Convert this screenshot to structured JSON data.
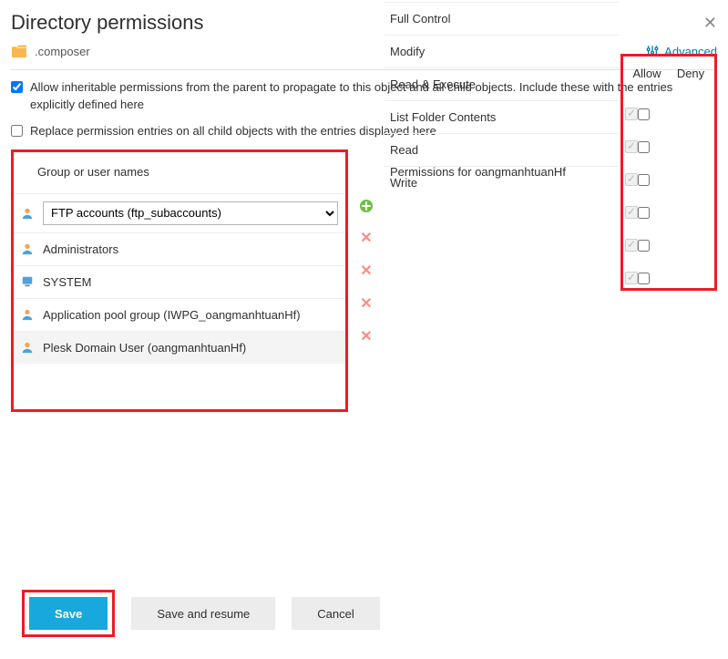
{
  "header": {
    "title": "Directory permissions"
  },
  "directory": {
    "name": ".composer"
  },
  "advanced": {
    "label": "Advanced"
  },
  "inherit": {
    "label": "Allow inheritable permissions from the parent to propagate to this object and all child objects. Include these with the entries explicitly defined here",
    "checked": true
  },
  "replace": {
    "label": "Replace permission entries on all child objects with the entries displayed here",
    "checked": false
  },
  "groups": {
    "header": "Group or user names",
    "select_value": "FTP accounts (ftp_subaccounts)",
    "items": [
      {
        "label": "Administrators",
        "kind": "user"
      },
      {
        "label": "SYSTEM",
        "kind": "system"
      },
      {
        "label": "Application pool group (IWPG_oangmanhtuanHf)",
        "kind": "user"
      },
      {
        "label": "Plesk Domain User (oangmanhtuanHf)",
        "kind": "user",
        "selected": true
      }
    ]
  },
  "permissions": {
    "header": "Permissions for oangmanhtuanHf",
    "allow_label": "Allow",
    "deny_label": "Deny",
    "rows": [
      {
        "label": "Full Control",
        "allow": true
      },
      {
        "label": "Modify",
        "allow": true
      },
      {
        "label": "Read & Execute",
        "allow": true
      },
      {
        "label": "List Folder Contents",
        "allow": true
      },
      {
        "label": "Read",
        "allow": true
      },
      {
        "label": "Write",
        "allow": true
      }
    ]
  },
  "buttons": {
    "save": "Save",
    "save_resume": "Save and resume",
    "cancel": "Cancel"
  }
}
